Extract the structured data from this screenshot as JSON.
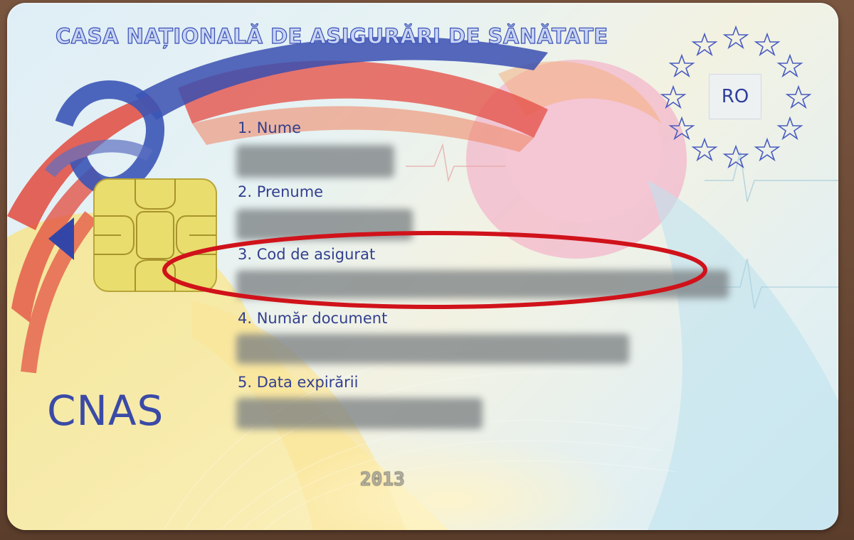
{
  "card": {
    "header": "CASA NAȚIONALĂ DE ASIGURĂRI DE SĂNĂTATE",
    "country_code": "RO",
    "logo_text": "CNAS",
    "year": "2013",
    "fields": [
      {
        "label": "1. Nume"
      },
      {
        "label": "2. Prenume"
      },
      {
        "label": "3. Cod de asigurat"
      },
      {
        "label": "4. Număr document"
      },
      {
        "label": "5. Data expirării"
      }
    ]
  },
  "colors": {
    "header_text": "#3b52b8",
    "label_text": "#33408f",
    "highlight_ellipse": "#d0121a",
    "redaction": "#7e8486"
  },
  "annotation": {
    "highlighted_field": "3. Cod de asigurat",
    "shape": "red ellipse"
  }
}
